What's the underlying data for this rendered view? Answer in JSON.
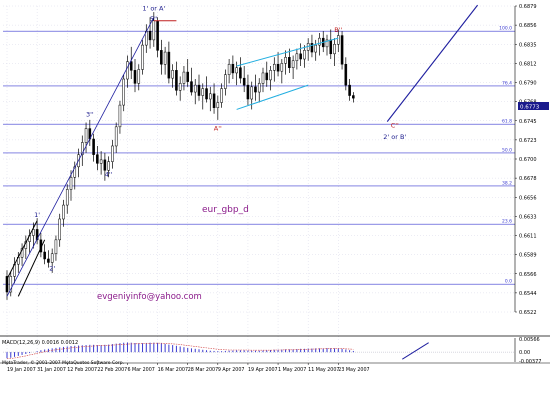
{
  "chart_data": {
    "type": "candlestick",
    "symbol": "eur_gbp_d",
    "contact": "evgeniyinfo@yahoo.com",
    "copyright": "MetaTrader, © 2001-2007 MetaQuotes Software Corp.",
    "price_panel": {
      "y_min": 0.6527,
      "y_max": 0.6879,
      "y_ticks": [
        "0.6879",
        "0.6856",
        "0.6835",
        "0.6812",
        "0.6790",
        "0.6768",
        "0.6745",
        "0.6723",
        "0.6700",
        "0.6678",
        "0.6656",
        "0.6633",
        "0.6611",
        "0.6589",
        "0.6566",
        "0.6544",
        "0.6522"
      ],
      "current_price": "0.6773",
      "fib_levels": [
        {
          "label": "100.0",
          "value": 0.685
        },
        {
          "label": "76.4",
          "value": 0.6787
        },
        {
          "label": "61.8",
          "value": 0.6743
        },
        {
          "label": "50.0",
          "value": 0.671
        },
        {
          "label": "38.2",
          "value": 0.6672
        },
        {
          "label": "23.6",
          "value": 0.6628
        },
        {
          "label": "0.0",
          "value": 0.6559
        }
      ],
      "wave_labels": [
        {
          "text": "1'",
          "color": "#1a1a8c",
          "bar": 8,
          "price": 0.6636
        },
        {
          "text": "2'",
          "color": "#1a1a8c",
          "bar": 12,
          "price": 0.6575
        },
        {
          "text": "3''",
          "color": "#1a1a8c",
          "bar": 22,
          "price": 0.6752
        },
        {
          "text": "4''",
          "color": "#1a1a8c",
          "bar": 27,
          "price": 0.6683
        },
        {
          "text": "1' or A'",
          "color": "#1a1a8c",
          "bar": 39,
          "price": 0.6874
        },
        {
          "text": "5''",
          "color": "#1a1a8c",
          "bar": 39,
          "price": 0.6862
        },
        {
          "text": "A''",
          "color": "#c02020",
          "bar": 56,
          "price": 0.6736
        },
        {
          "text": "B''",
          "color": "#c02020",
          "bar": 88,
          "price": 0.6849
        },
        {
          "text": "C''",
          "color": "#c02020",
          "bar": 103,
          "price": 0.6739
        },
        {
          "text": "2' or B'",
          "color": "#1a1a8c",
          "bar": 103,
          "price": 0.6726
        }
      ]
    },
    "macd_panel": {
      "label": "MACD(12,26,9) 0.0016 0.0012",
      "y_ticks": [
        "0.00566",
        "0.00",
        "-0.00377"
      ],
      "y_min": -0.0042,
      "y_max": 0.006
    },
    "x_ticks": [
      "19 Jan 2007",
      "31 Jan 2007",
      "12 Feb 2007",
      "22 Feb 2007",
      "6 Mar 2007",
      "16 Mar 2007",
      "28 Mar 2007",
      "9 Apr 2007",
      "19 Apr 2007",
      "1 May 2007",
      "11 May 2007",
      "23 May 2007"
    ],
    "x_tick_bars": [
      0,
      8,
      16,
      24,
      32,
      40,
      48,
      56,
      64,
      72,
      80,
      88
    ],
    "candles": [
      {
        "o": 0.6568,
        "h": 0.6575,
        "l": 0.6541,
        "c": 0.655
      },
      {
        "o": 0.655,
        "h": 0.6574,
        "l": 0.6545,
        "c": 0.6568
      },
      {
        "o": 0.6568,
        "h": 0.659,
        "l": 0.656,
        "c": 0.6582
      },
      {
        "o": 0.6582,
        "h": 0.6596,
        "l": 0.6572,
        "c": 0.659
      },
      {
        "o": 0.659,
        "h": 0.6606,
        "l": 0.658,
        "c": 0.66
      },
      {
        "o": 0.66,
        "h": 0.6615,
        "l": 0.6588,
        "c": 0.6608
      },
      {
        "o": 0.6608,
        "h": 0.6622,
        "l": 0.6595,
        "c": 0.6615
      },
      {
        "o": 0.6615,
        "h": 0.663,
        "l": 0.66,
        "c": 0.6622
      },
      {
        "o": 0.6622,
        "h": 0.6635,
        "l": 0.6605,
        "c": 0.661
      },
      {
        "o": 0.661,
        "h": 0.6618,
        "l": 0.659,
        "c": 0.6596
      },
      {
        "o": 0.6596,
        "h": 0.6605,
        "l": 0.6582,
        "c": 0.6588
      },
      {
        "o": 0.6588,
        "h": 0.6598,
        "l": 0.6578,
        "c": 0.6584
      },
      {
        "o": 0.6584,
        "h": 0.66,
        "l": 0.6572,
        "c": 0.6594
      },
      {
        "o": 0.6594,
        "h": 0.6615,
        "l": 0.6586,
        "c": 0.661
      },
      {
        "o": 0.661,
        "h": 0.664,
        "l": 0.6602,
        "c": 0.6634
      },
      {
        "o": 0.6634,
        "h": 0.6656,
        "l": 0.6625,
        "c": 0.665
      },
      {
        "o": 0.665,
        "h": 0.6674,
        "l": 0.664,
        "c": 0.6668
      },
      {
        "o": 0.6668,
        "h": 0.669,
        "l": 0.6655,
        "c": 0.6682
      },
      {
        "o": 0.6682,
        "h": 0.67,
        "l": 0.6668,
        "c": 0.6694
      },
      {
        "o": 0.6694,
        "h": 0.6715,
        "l": 0.6682,
        "c": 0.6708
      },
      {
        "o": 0.6708,
        "h": 0.673,
        "l": 0.6695,
        "c": 0.6722
      },
      {
        "o": 0.6722,
        "h": 0.6745,
        "l": 0.671,
        "c": 0.6738
      },
      {
        "o": 0.6738,
        "h": 0.6748,
        "l": 0.6718,
        "c": 0.6726
      },
      {
        "o": 0.6726,
        "h": 0.6732,
        "l": 0.67,
        "c": 0.6708
      },
      {
        "o": 0.6708,
        "h": 0.6718,
        "l": 0.669,
        "c": 0.6698
      },
      {
        "o": 0.6698,
        "h": 0.6712,
        "l": 0.6685,
        "c": 0.6702
      },
      {
        "o": 0.6702,
        "h": 0.671,
        "l": 0.6678,
        "c": 0.669
      },
      {
        "o": 0.669,
        "h": 0.6706,
        "l": 0.6682,
        "c": 0.67
      },
      {
        "o": 0.67,
        "h": 0.6725,
        "l": 0.6692,
        "c": 0.6718
      },
      {
        "o": 0.6718,
        "h": 0.6745,
        "l": 0.671,
        "c": 0.674
      },
      {
        "o": 0.674,
        "h": 0.677,
        "l": 0.6732,
        "c": 0.6765
      },
      {
        "o": 0.6765,
        "h": 0.68,
        "l": 0.6758,
        "c": 0.6795
      },
      {
        "o": 0.6795,
        "h": 0.6822,
        "l": 0.6785,
        "c": 0.6815
      },
      {
        "o": 0.6815,
        "h": 0.6832,
        "l": 0.6795,
        "c": 0.6805
      },
      {
        "o": 0.6805,
        "h": 0.6818,
        "l": 0.678,
        "c": 0.679
      },
      {
        "o": 0.679,
        "h": 0.6812,
        "l": 0.6782,
        "c": 0.6806
      },
      {
        "o": 0.6806,
        "h": 0.684,
        "l": 0.68,
        "c": 0.6834
      },
      {
        "o": 0.6834,
        "h": 0.6858,
        "l": 0.6825,
        "c": 0.685
      },
      {
        "o": 0.685,
        "h": 0.6866,
        "l": 0.683,
        "c": 0.684
      },
      {
        "o": 0.684,
        "h": 0.6872,
        "l": 0.6832,
        "c": 0.6862
      },
      {
        "o": 0.6862,
        "h": 0.6866,
        "l": 0.682,
        "c": 0.6828
      },
      {
        "o": 0.6828,
        "h": 0.684,
        "l": 0.68,
        "c": 0.6812
      },
      {
        "o": 0.6812,
        "h": 0.6832,
        "l": 0.68,
        "c": 0.6826
      },
      {
        "o": 0.6826,
        "h": 0.6838,
        "l": 0.679,
        "c": 0.6796
      },
      {
        "o": 0.6796,
        "h": 0.6812,
        "l": 0.6785,
        "c": 0.6805
      },
      {
        "o": 0.6805,
        "h": 0.6815,
        "l": 0.6776,
        "c": 0.6782
      },
      {
        "o": 0.6782,
        "h": 0.6798,
        "l": 0.677,
        "c": 0.679
      },
      {
        "o": 0.679,
        "h": 0.681,
        "l": 0.6782,
        "c": 0.6803
      },
      {
        "o": 0.6803,
        "h": 0.6818,
        "l": 0.6786,
        "c": 0.6792
      },
      {
        "o": 0.6792,
        "h": 0.6808,
        "l": 0.6776,
        "c": 0.678
      },
      {
        "o": 0.678,
        "h": 0.6795,
        "l": 0.6766,
        "c": 0.6788
      },
      {
        "o": 0.6788,
        "h": 0.68,
        "l": 0.677,
        "c": 0.6776
      },
      {
        "o": 0.6776,
        "h": 0.679,
        "l": 0.676,
        "c": 0.6784
      },
      {
        "o": 0.6784,
        "h": 0.6798,
        "l": 0.6768,
        "c": 0.6772
      },
      {
        "o": 0.6772,
        "h": 0.6786,
        "l": 0.6758,
        "c": 0.6778
      },
      {
        "o": 0.6778,
        "h": 0.679,
        "l": 0.6755,
        "c": 0.6762
      },
      {
        "o": 0.6762,
        "h": 0.6776,
        "l": 0.6748,
        "c": 0.6768
      },
      {
        "o": 0.6768,
        "h": 0.679,
        "l": 0.6762,
        "c": 0.6784
      },
      {
        "o": 0.6784,
        "h": 0.6806,
        "l": 0.6776,
        "c": 0.68
      },
      {
        "o": 0.68,
        "h": 0.6818,
        "l": 0.679,
        "c": 0.6812
      },
      {
        "o": 0.6812,
        "h": 0.6822,
        "l": 0.6795,
        "c": 0.6802
      },
      {
        "o": 0.6802,
        "h": 0.6815,
        "l": 0.6788,
        "c": 0.6808
      },
      {
        "o": 0.6808,
        "h": 0.682,
        "l": 0.679,
        "c": 0.6796
      },
      {
        "o": 0.6796,
        "h": 0.681,
        "l": 0.678,
        "c": 0.6788
      },
      {
        "o": 0.6788,
        "h": 0.68,
        "l": 0.6765,
        "c": 0.6772
      },
      {
        "o": 0.6772,
        "h": 0.6792,
        "l": 0.676,
        "c": 0.6786
      },
      {
        "o": 0.6786,
        "h": 0.68,
        "l": 0.677,
        "c": 0.678
      },
      {
        "o": 0.678,
        "h": 0.6796,
        "l": 0.6768,
        "c": 0.679
      },
      {
        "o": 0.679,
        "h": 0.6808,
        "l": 0.678,
        "c": 0.6802
      },
      {
        "o": 0.6802,
        "h": 0.6815,
        "l": 0.6786,
        "c": 0.6794
      },
      {
        "o": 0.6794,
        "h": 0.681,
        "l": 0.6782,
        "c": 0.6805
      },
      {
        "o": 0.6805,
        "h": 0.682,
        "l": 0.6792,
        "c": 0.6812
      },
      {
        "o": 0.6812,
        "h": 0.6826,
        "l": 0.6798,
        "c": 0.6804
      },
      {
        "o": 0.6804,
        "h": 0.6818,
        "l": 0.679,
        "c": 0.6813
      },
      {
        "o": 0.6813,
        "h": 0.6828,
        "l": 0.68,
        "c": 0.682
      },
      {
        "o": 0.682,
        "h": 0.683,
        "l": 0.6802,
        "c": 0.6808
      },
      {
        "o": 0.6808,
        "h": 0.6822,
        "l": 0.6795,
        "c": 0.6816
      },
      {
        "o": 0.6816,
        "h": 0.683,
        "l": 0.6806,
        "c": 0.6824
      },
      {
        "o": 0.6824,
        "h": 0.6836,
        "l": 0.681,
        "c": 0.6818
      },
      {
        "o": 0.6818,
        "h": 0.6834,
        "l": 0.6808,
        "c": 0.6828
      },
      {
        "o": 0.6828,
        "h": 0.6842,
        "l": 0.6816,
        "c": 0.6836
      },
      {
        "o": 0.6836,
        "h": 0.6846,
        "l": 0.682,
        "c": 0.6826
      },
      {
        "o": 0.6826,
        "h": 0.684,
        "l": 0.6816,
        "c": 0.6834
      },
      {
        "o": 0.6834,
        "h": 0.6848,
        "l": 0.6822,
        "c": 0.6842
      },
      {
        "o": 0.6842,
        "h": 0.685,
        "l": 0.6826,
        "c": 0.6832
      },
      {
        "o": 0.6832,
        "h": 0.6846,
        "l": 0.6822,
        "c": 0.684
      },
      {
        "o": 0.684,
        "h": 0.6852,
        "l": 0.6818,
        "c": 0.6824
      },
      {
        "o": 0.6824,
        "h": 0.6842,
        "l": 0.681,
        "c": 0.6835
      },
      {
        "o": 0.6835,
        "h": 0.6852,
        "l": 0.6826,
        "c": 0.6845
      },
      {
        "o": 0.6845,
        "h": 0.685,
        "l": 0.6806,
        "c": 0.6812
      },
      {
        "o": 0.6812,
        "h": 0.682,
        "l": 0.6782,
        "c": 0.6788
      },
      {
        "o": 0.6788,
        "h": 0.6795,
        "l": 0.677,
        "c": 0.6776
      },
      {
        "o": 0.6776,
        "h": 0.678,
        "l": 0.6768,
        "c": 0.6773
      }
    ],
    "macd_hist": [
      -0.0026,
      -0.0024,
      -0.002,
      -0.0016,
      -0.0012,
      -0.0008,
      -0.0004,
      0.0,
      0.0004,
      0.0008,
      0.0011,
      0.0014,
      0.0016,
      0.0018,
      0.002,
      0.0022,
      0.0024,
      0.0026,
      0.0027,
      0.0028,
      0.0029,
      0.003,
      0.0031,
      0.0031,
      0.003,
      0.003,
      0.0031,
      0.0032,
      0.0034,
      0.0036,
      0.0038,
      0.004,
      0.0041,
      0.004,
      0.0039,
      0.0038,
      0.0038,
      0.0039,
      0.004,
      0.004,
      0.0039,
      0.0037,
      0.0035,
      0.0032,
      0.003,
      0.0027,
      0.0024,
      0.0021,
      0.0018,
      0.0016,
      0.0014,
      0.0012,
      0.001,
      0.0008,
      0.0006,
      0.0005,
      0.0004,
      0.0004,
      0.0005,
      0.0006,
      0.0007,
      0.0008,
      0.0008,
      0.0008,
      0.0007,
      0.0006,
      0.0006,
      0.0006,
      0.0007,
      0.0008,
      0.0009,
      0.001,
      0.001,
      0.0011,
      0.0012,
      0.0012,
      0.0012,
      0.0013,
      0.0014,
      0.0014,
      0.0015,
      0.0015,
      0.0016,
      0.0016,
      0.0016,
      0.0017,
      0.0017,
      0.0016,
      0.0016,
      0.0014,
      0.0011,
      0.0008,
      0.0005
    ],
    "macd_signal": [
      -0.0028,
      -0.0027,
      -0.0025,
      -0.0022,
      -0.0019,
      -0.0016,
      -0.0012,
      -0.0009,
      -0.0005,
      -0.0002,
      0.0002,
      0.0005,
      0.0008,
      0.001,
      0.0012,
      0.0014,
      0.0016,
      0.0018,
      0.002,
      0.0021,
      0.0023,
      0.0024,
      0.0025,
      0.0026,
      0.0027,
      0.0028,
      0.0028,
      0.0029,
      0.003,
      0.0031,
      0.0032,
      0.0033,
      0.0034,
      0.0035,
      0.0035,
      0.0036,
      0.0036,
      0.0037,
      0.0037,
      0.0038,
      0.0038,
      0.0038,
      0.0037,
      0.0036,
      0.0035,
      0.0034,
      0.0032,
      0.003,
      0.0028,
      0.0026,
      0.0024,
      0.0022,
      0.002,
      0.0018,
      0.0016,
      0.0014,
      0.0012,
      0.0011,
      0.001,
      0.0009,
      0.0009,
      0.0009,
      0.0009,
      0.0009,
      0.0009,
      0.0008,
      0.0008,
      0.0008,
      0.0008,
      0.0008,
      0.0008,
      0.0009,
      0.0009,
      0.0009,
      0.001,
      0.001,
      0.001,
      0.0011,
      0.0011,
      0.0012,
      0.0012,
      0.0013,
      0.0013,
      0.0014,
      0.0014,
      0.0015,
      0.0015,
      0.0015,
      0.0015,
      0.0015,
      0.0014,
      0.0013,
      0.0012
    ]
  },
  "colors": {
    "candle_up": "#ffffff",
    "candle_down": "#000000",
    "candle_edge": "#000000",
    "fib_lines": "#3a3ad0",
    "channel": "#22aee0",
    "trend": "#2020a0",
    "labels_red": "#c02020",
    "labels_blue": "#1a1a8c",
    "macd_hist": "#3a3ad0",
    "macd_signal": "#d04040",
    "grid": "#d8d8e8",
    "price_box": "#1a1a8c"
  }
}
